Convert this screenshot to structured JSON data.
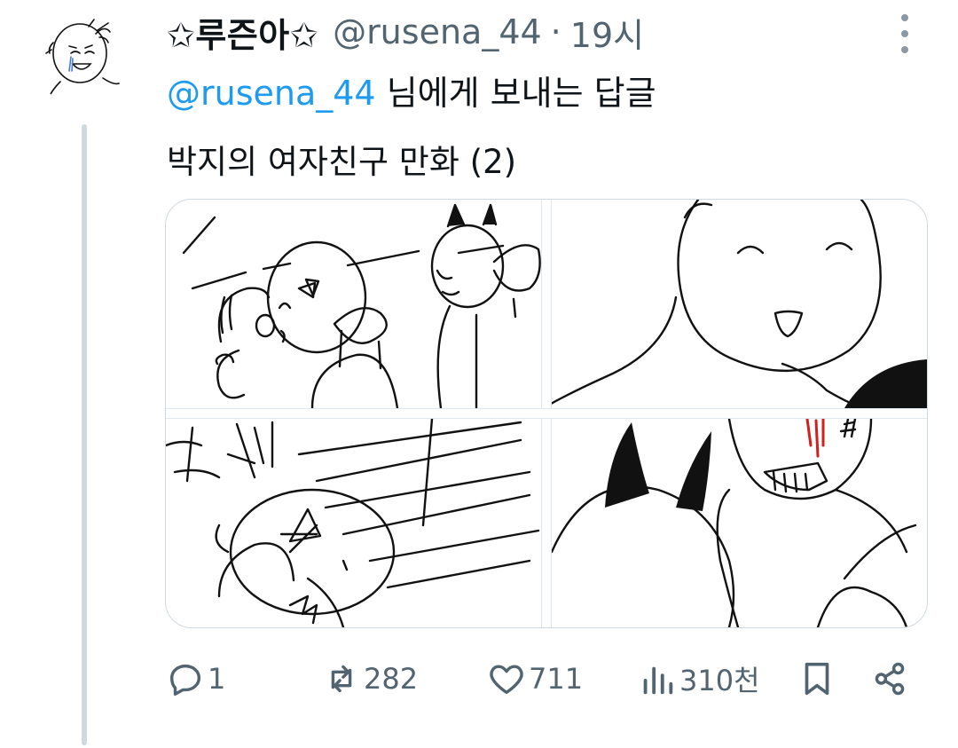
{
  "tweet": {
    "display_name": "✩루즌아✩",
    "handle": "@rusena_44",
    "separator": "·",
    "time": "19시",
    "reply_mention": "@rusena_44",
    "reply_suffix": " 님에게 보내는 답글",
    "text": "박지의 여자친구 만화 (2)"
  },
  "media": {
    "panels": [
      "panel-1",
      "panel-2",
      "panel-3",
      "panel-4"
    ],
    "panel_4_redline_color": "#d21f1f"
  },
  "actions": {
    "reply_count": "1",
    "repost_count": "282",
    "like_count": "711",
    "view_count": "310천"
  },
  "icons": {
    "reply": "speech-bubble-icon",
    "repost": "repost-arrows-icon",
    "like": "heart-icon",
    "views": "bar-chart-icon",
    "bookmark": "bookmark-icon",
    "share": "share-icon",
    "more": "more-vertical-icon"
  },
  "colors": {
    "mention": "#1d9bf0",
    "secondary_text": "#536471",
    "thread_line": "#cfd9de"
  }
}
